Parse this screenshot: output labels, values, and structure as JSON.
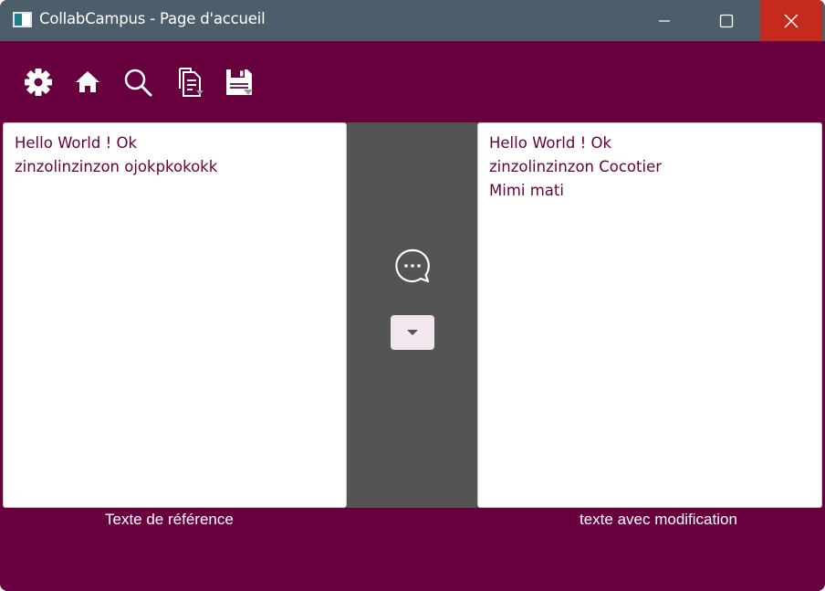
{
  "window": {
    "title": "CollabCampus - Page d'accueil",
    "icons": {
      "app": "app-window-icon",
      "minimize": "minimize-icon",
      "maximize": "maximize-icon",
      "close": "close-icon"
    },
    "colors": {
      "titlebar": "#4d5e6b",
      "close_button": "#c42b1c",
      "accent": "#68003f",
      "middle_panel": "#545454"
    }
  },
  "toolbar": {
    "items": [
      {
        "icon": "gear-icon"
      },
      {
        "icon": "home-icon"
      },
      {
        "icon": "search-icon"
      },
      {
        "icon": "document-dropdown-icon"
      },
      {
        "icon": "save-icon"
      }
    ]
  },
  "reference_panel": {
    "lines": [
      "Hello World ! Ok",
      "zinzolinzinzon ojokpkokokk"
    ],
    "caption": "Texte de référence"
  },
  "modified_panel": {
    "lines": [
      "Hello World ! Ok",
      "zinzolinzinzon Cocotier",
      "Mimi mati"
    ],
    "caption": "texte avec modification"
  },
  "middle": {
    "chat_icon": "chat-bubble-icon",
    "dropdown_icon": "caret-down-icon"
  }
}
